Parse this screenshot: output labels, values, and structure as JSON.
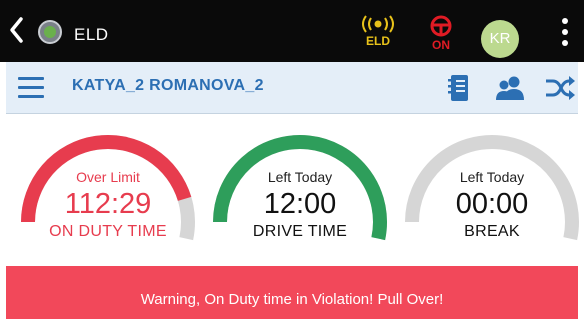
{
  "app": {
    "title": "ELD"
  },
  "status": {
    "eld_label": "ELD",
    "on_label": "ON",
    "eld_color": "#e8c21a",
    "on_color": "#e01b24"
  },
  "user": {
    "initials": "KR",
    "driver_name": "KATYA_2 ROMANOVA_2"
  },
  "gauges": [
    {
      "sub": "Over Limit",
      "value": "112:29",
      "label": "ON DUTY TIME",
      "color": "#e73c4e",
      "fill": 0.85
    },
    {
      "sub": "Left Today",
      "value": "12:00",
      "label": "DRIVE TIME",
      "color": "#2e9e5b",
      "fill": 1.0
    },
    {
      "sub": "Left Today",
      "value": "00:00",
      "label": "BREAK",
      "color": "#d6d6d6",
      "fill": 0.0
    }
  ],
  "warning": {
    "text": "Warning, On Duty time in Violation! Pull Over!"
  },
  "icons": [
    "back-chevron-icon",
    "app-logo-icon",
    "eld-signal-icon",
    "steering-wheel-icon",
    "kebab-menu-icon",
    "hamburger-menu-icon",
    "logbook-icon",
    "group-users-icon",
    "shuffle-icon"
  ]
}
